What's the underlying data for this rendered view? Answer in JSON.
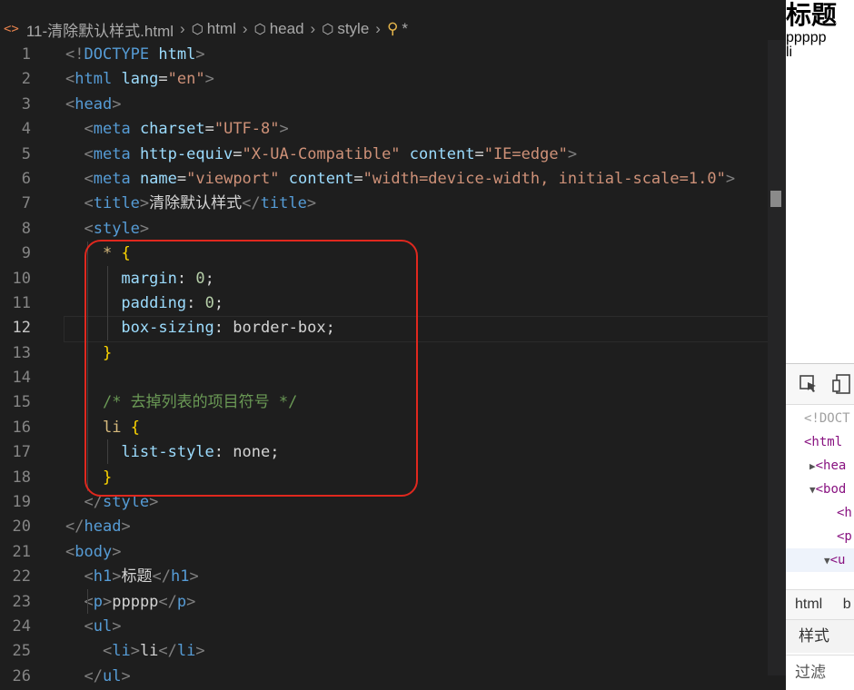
{
  "breadcrumb": {
    "file": "11-清除默认样式.html",
    "items": [
      "html",
      "head",
      "style"
    ],
    "selector": "*"
  },
  "lines": [
    {
      "n": "1",
      "tokens": [
        [
          "tg",
          "<!"
        ],
        [
          "tn",
          "DOCTYPE"
        ],
        [
          "tx",
          " "
        ],
        [
          "at",
          "html"
        ],
        [
          "tg",
          ">"
        ]
      ]
    },
    {
      "n": "2",
      "tokens": [
        [
          "tg",
          "<"
        ],
        [
          "tn",
          "html"
        ],
        [
          "tx",
          " "
        ],
        [
          "at",
          "lang"
        ],
        [
          "tx",
          "="
        ],
        [
          "st",
          "\"en\""
        ],
        [
          "tg",
          ">"
        ]
      ]
    },
    {
      "n": "3",
      "tokens": [
        [
          "tg",
          "<"
        ],
        [
          "tn",
          "head"
        ],
        [
          "tg",
          ">"
        ]
      ]
    },
    {
      "n": "4",
      "tokens": [
        [
          "tx",
          "  "
        ],
        [
          "tg",
          "<"
        ],
        [
          "tn",
          "meta"
        ],
        [
          "tx",
          " "
        ],
        [
          "at",
          "charset"
        ],
        [
          "tx",
          "="
        ],
        [
          "st",
          "\"UTF-8\""
        ],
        [
          "tg",
          ">"
        ]
      ]
    },
    {
      "n": "5",
      "tokens": [
        [
          "tx",
          "  "
        ],
        [
          "tg",
          "<"
        ],
        [
          "tn",
          "meta"
        ],
        [
          "tx",
          " "
        ],
        [
          "at",
          "http-equiv"
        ],
        [
          "tx",
          "="
        ],
        [
          "st",
          "\"X-UA-Compatible\""
        ],
        [
          "tx",
          " "
        ],
        [
          "at",
          "content"
        ],
        [
          "tx",
          "="
        ],
        [
          "st",
          "\"IE=edge\""
        ],
        [
          "tg",
          ">"
        ]
      ]
    },
    {
      "n": "6",
      "tokens": [
        [
          "tx",
          "  "
        ],
        [
          "tg",
          "<"
        ],
        [
          "tn",
          "meta"
        ],
        [
          "tx",
          " "
        ],
        [
          "at",
          "name"
        ],
        [
          "tx",
          "="
        ],
        [
          "st",
          "\"viewport\""
        ],
        [
          "tx",
          " "
        ],
        [
          "at",
          "content"
        ],
        [
          "tx",
          "="
        ],
        [
          "st",
          "\"width=device-width, initial-scale=1.0\""
        ],
        [
          "tg",
          ">"
        ]
      ]
    },
    {
      "n": "7",
      "tokens": [
        [
          "tx",
          "  "
        ],
        [
          "tg",
          "<"
        ],
        [
          "tn",
          "title"
        ],
        [
          "tg",
          ">"
        ],
        [
          "tx",
          "清除默认样式"
        ],
        [
          "tg",
          "</"
        ],
        [
          "tn",
          "title"
        ],
        [
          "tg",
          ">"
        ]
      ]
    },
    {
      "n": "8",
      "tokens": [
        [
          "tx",
          "  "
        ],
        [
          "tg",
          "<"
        ],
        [
          "tn",
          "style"
        ],
        [
          "tg",
          ">"
        ]
      ]
    },
    {
      "n": "9",
      "tokens": [
        [
          "tx",
          "    "
        ],
        [
          "sl",
          "*"
        ],
        [
          "tx",
          " "
        ],
        [
          "br",
          "{"
        ]
      ]
    },
    {
      "n": "10",
      "tokens": [
        [
          "tx",
          "      "
        ],
        [
          "pr",
          "margin"
        ],
        [
          "tx",
          ": "
        ],
        [
          "nm",
          "0"
        ],
        [
          "tx",
          ";"
        ]
      ]
    },
    {
      "n": "11",
      "tokens": [
        [
          "tx",
          "      "
        ],
        [
          "pr",
          "padding"
        ],
        [
          "tx",
          ": "
        ],
        [
          "nm",
          "0"
        ],
        [
          "tx",
          ";"
        ]
      ]
    },
    {
      "n": "12",
      "tokens": [
        [
          "tx",
          "      "
        ],
        [
          "pr",
          "box-sizing"
        ],
        [
          "tx",
          ": "
        ],
        [
          "vl",
          "border-box"
        ],
        [
          "tx",
          ";"
        ]
      ]
    },
    {
      "n": "13",
      "tokens": [
        [
          "tx",
          "    "
        ],
        [
          "br",
          "}"
        ]
      ]
    },
    {
      "n": "14",
      "tokens": []
    },
    {
      "n": "15",
      "tokens": [
        [
          "tx",
          "    "
        ],
        [
          "cm",
          "/* 去掉列表的项目符号 */"
        ]
      ]
    },
    {
      "n": "16",
      "tokens": [
        [
          "tx",
          "    "
        ],
        [
          "sl",
          "li"
        ],
        [
          "tx",
          " "
        ],
        [
          "br",
          "{"
        ]
      ]
    },
    {
      "n": "17",
      "tokens": [
        [
          "tx",
          "      "
        ],
        [
          "pr",
          "list-style"
        ],
        [
          "tx",
          ": "
        ],
        [
          "vl",
          "none"
        ],
        [
          "tx",
          ";"
        ]
      ]
    },
    {
      "n": "18",
      "tokens": [
        [
          "tx",
          "    "
        ],
        [
          "br",
          "}"
        ]
      ]
    },
    {
      "n": "19",
      "tokens": [
        [
          "tx",
          "  "
        ],
        [
          "tg",
          "</"
        ],
        [
          "tn",
          "style"
        ],
        [
          "tg",
          ">"
        ]
      ]
    },
    {
      "n": "20",
      "tokens": [
        [
          "tg",
          "</"
        ],
        [
          "tn",
          "head"
        ],
        [
          "tg",
          ">"
        ]
      ]
    },
    {
      "n": "21",
      "tokens": [
        [
          "tg",
          "<"
        ],
        [
          "tn",
          "body"
        ],
        [
          "tg",
          ">"
        ]
      ]
    },
    {
      "n": "22",
      "tokens": [
        [
          "tx",
          "  "
        ],
        [
          "tg",
          "<"
        ],
        [
          "tn",
          "h1"
        ],
        [
          "tg",
          ">"
        ],
        [
          "tx",
          "标题"
        ],
        [
          "tg",
          "</"
        ],
        [
          "tn",
          "h1"
        ],
        [
          "tg",
          ">"
        ]
      ]
    },
    {
      "n": "23",
      "tokens": [
        [
          "tx",
          "  "
        ],
        [
          "tg",
          "<"
        ],
        [
          "tn",
          "p"
        ],
        [
          "tg",
          ">"
        ],
        [
          "tx",
          "ppppp"
        ],
        [
          "tg",
          "</"
        ],
        [
          "tn",
          "p"
        ],
        [
          "tg",
          ">"
        ]
      ]
    },
    {
      "n": "24",
      "tokens": [
        [
          "tx",
          "  "
        ],
        [
          "tg",
          "<"
        ],
        [
          "tn",
          "ul"
        ],
        [
          "tg",
          ">"
        ]
      ]
    },
    {
      "n": "25",
      "tokens": [
        [
          "tx",
          "    "
        ],
        [
          "tg",
          "<"
        ],
        [
          "tn",
          "li"
        ],
        [
          "tg",
          ">"
        ],
        [
          "tx",
          "li"
        ],
        [
          "tg",
          "</"
        ],
        [
          "tn",
          "li"
        ],
        [
          "tg",
          ">"
        ]
      ]
    },
    {
      "n": "26",
      "tokens": [
        [
          "tx",
          "  "
        ],
        [
          "tg",
          "</"
        ],
        [
          "tn",
          "ul"
        ],
        [
          "tg",
          ">"
        ]
      ]
    }
  ],
  "active_line": "12",
  "preview": {
    "heading": "标题",
    "paragraph": "ppppp",
    "list_item": "li"
  },
  "devtools": {
    "dom_lines": [
      {
        "text": "<!DOCT"
      },
      {
        "text": "<html"
      },
      {
        "tri": "▶",
        "text": "<hea"
      },
      {
        "tri": "▼",
        "text": "<bod"
      },
      {
        "text": "<h"
      },
      {
        "text": "<p"
      },
      {
        "tri": "▼",
        "text": "<u"
      }
    ],
    "breadcrumb": [
      "html",
      "b"
    ],
    "styles_tab": "样式",
    "filter_label": "过滤"
  }
}
